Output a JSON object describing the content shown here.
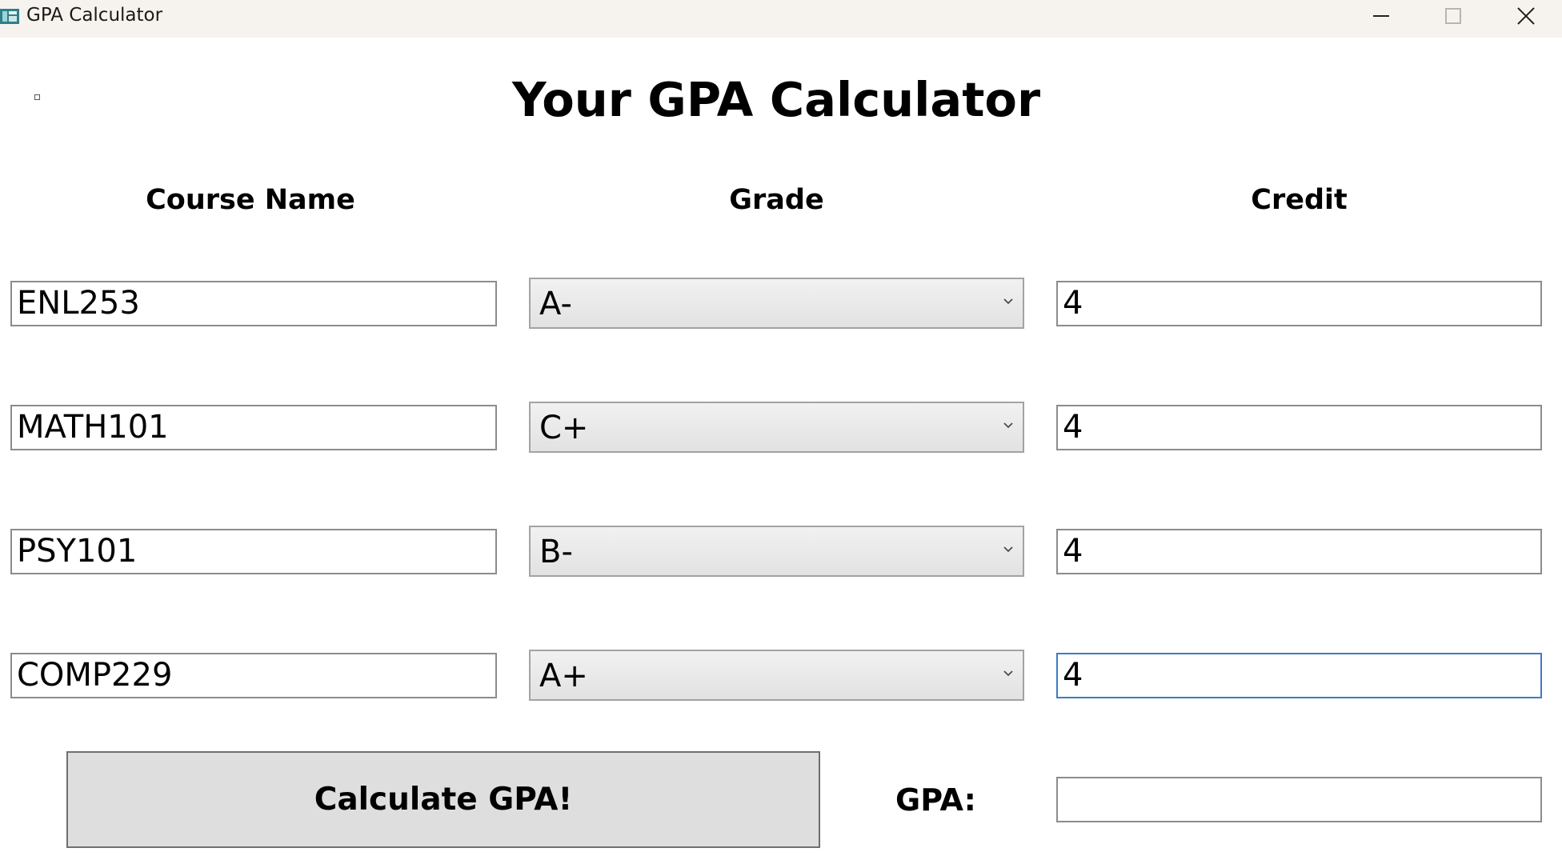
{
  "window": {
    "title": "GPA Calculator"
  },
  "heading": "Your GPA Calculator",
  "columns": {
    "course": "Course Name",
    "grade": "Grade",
    "credit": "Credit"
  },
  "rows": [
    {
      "course": "ENL253",
      "grade": "A-",
      "credit": "4"
    },
    {
      "course": "MATH101",
      "grade": "C+",
      "credit": "4"
    },
    {
      "course": "PSY101",
      "grade": "B-",
      "credit": "4"
    },
    {
      "course": "COMP229",
      "grade": "A+",
      "credit": "4"
    }
  ],
  "calculate_label": "Calculate GPA!",
  "gpa": {
    "label": "GPA:",
    "value": ""
  },
  "colors": {
    "focus_border": "#3d7bc4",
    "button_bg": "#dedede",
    "titlebar_bg": "#f6f3ee"
  }
}
